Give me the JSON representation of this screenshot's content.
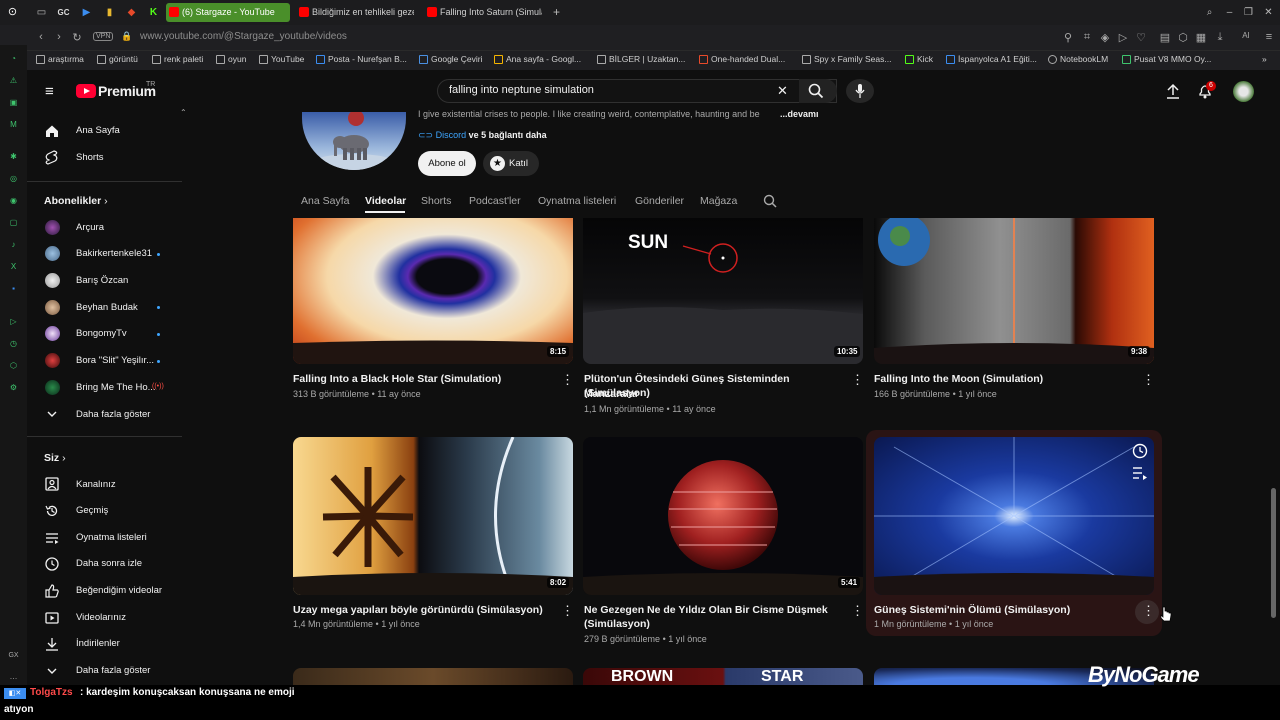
{
  "browser": {
    "tabs": [
      {
        "label": "",
        "color": "#888888"
      },
      {
        "label": "(6) Stargaze - YouTube",
        "color": "#ff0000",
        "active": true
      },
      {
        "label": "Bildiğimiz en tehlikeli gezeg",
        "color": "#ff0000"
      },
      {
        "label": "Falling Into Saturn (Simulati",
        "color": "#ff0000"
      }
    ],
    "tab_left_icons": [
      "GC"
    ],
    "url": "www.youtube.com/@Stargaze_youtube/videos",
    "vpn_label": "VPN",
    "bookmarks": [
      "araştırma",
      "görüntü",
      "renk paleti",
      "oyun",
      "YouTube",
      "Posta - Nurefşan B...",
      "Google Çeviri",
      "Ana sayfa - Googl...",
      "BİLGER | Uzaktan...",
      "One-handed Dual...",
      "Spy x Family Seas...",
      "Kick",
      "İspanyolca A1 Eğiti...",
      "NotebookLM",
      "Pusat V8 MMO Oy..."
    ],
    "sidebar_bottom_label": "GX"
  },
  "youtube": {
    "logo_text": "Premium",
    "logo_region": "TR",
    "search_value": "falling into neptune simulation",
    "notification_count": "6",
    "sidebar": {
      "main": [
        {
          "label": "Ana Sayfa",
          "icon": "home-icon"
        },
        {
          "label": "Shorts",
          "icon": "shorts-icon"
        }
      ],
      "subscriptions_title": "Abonelikler",
      "subscriptions": [
        {
          "label": "Arçura",
          "color": "#6a3a7a",
          "new": false
        },
        {
          "label": "Bakirkertenkele31",
          "color": "#6a88a6",
          "new": true
        },
        {
          "label": "Barış Özcan",
          "color": "#cfcfcf",
          "new": false
        },
        {
          "label": "Beyhan Budak",
          "color": "#b08870",
          "new": true
        },
        {
          "label": "BongomyTv",
          "color": "#9060c0",
          "new": true
        },
        {
          "label": "Bora \"Slit\" Yeşilır...",
          "color": "#c02828",
          "new": true
        },
        {
          "label": "Bring Me The Ho...",
          "color": "#1c6a3a",
          "live": true
        }
      ],
      "show_more": "Daha fazla göster",
      "you_title": "Siz",
      "you_items": [
        {
          "label": "Kanalınız",
          "icon": "channel-icon"
        },
        {
          "label": "Geçmiş",
          "icon": "history-icon"
        },
        {
          "label": "Oynatma listeleri",
          "icon": "playlist-icon"
        },
        {
          "label": "Daha sonra izle",
          "icon": "watch-later-icon"
        },
        {
          "label": "Beğendiğim videolar",
          "icon": "thumbs-up-icon"
        },
        {
          "label": "Videolarınız",
          "icon": "video-icon"
        },
        {
          "label": "İndirilenler",
          "icon": "download-icon"
        },
        {
          "label": "Daha fazla göster",
          "icon": "chevron-down-icon"
        }
      ]
    },
    "channel": {
      "description": "I give existential crises to people. I like creating weird, contemplative, haunting and be",
      "more_label": "...devamı",
      "links_label": "Discord",
      "links_more": " ve 5 bağlantı daha",
      "subscribe_label": "Abone ol",
      "join_label": "Katıl"
    },
    "channel_tabs": [
      "Ana Sayfa",
      "Videolar",
      "Shorts",
      "Podcast'ler",
      "Oynatma listeleri",
      "Gönderiler",
      "Mağaza"
    ],
    "selected_tab": "Videolar",
    "videos": [
      {
        "title": "Falling Into a Black Hole Star (Simulation)",
        "title2": "",
        "views": "313 B görüntüleme",
        "age": "11 ay önce",
        "duration": "8:15"
      },
      {
        "title": "Plüton'un Ötesindeki Güneş Sisteminden Manzaralar",
        "title2": "(Simülasyon)",
        "views": "1,1 Mn görüntüleme",
        "age": "11 ay önce",
        "duration": "10:35",
        "overlay": "SUN"
      },
      {
        "title": "Falling Into the Moon (Simulation)",
        "title2": "",
        "views": "166 B görüntüleme",
        "age": "1 yıl önce",
        "duration": "9:38"
      },
      {
        "title": "Uzay mega yapıları böyle görünürdü (Simülasyon)",
        "title2": "",
        "views": "1,4 Mn görüntüleme",
        "age": "1 yıl önce",
        "duration": "8:02"
      },
      {
        "title": "Ne Gezegen Ne de Yıldız Olan Bir Cisme Düşmek",
        "title2": "(Simülasyon)",
        "views": "279 B görüntüleme",
        "age": "1 yıl önce",
        "duration": "5:41"
      },
      {
        "title": "Güneş Sistemi'nin Ölümü (Simülasyon)",
        "title2": "",
        "views": "1 Mn görüntüleme",
        "age": "1 yıl önce",
        "duration": ""
      }
    ],
    "next_row_overlays": [
      "BROWN",
      "STAR"
    ]
  },
  "stream": {
    "chat_user": "TolgaTzs",
    "chat_message": ": kardeşim konuşcaksan konuşsana ne emoji",
    "chat_message2": "atıyon",
    "watermark": "ByNoGame"
  },
  "colors": {
    "accent_red": "#ff0033",
    "link_blue": "#3ea6ff",
    "bg": "#0f0f0f"
  }
}
